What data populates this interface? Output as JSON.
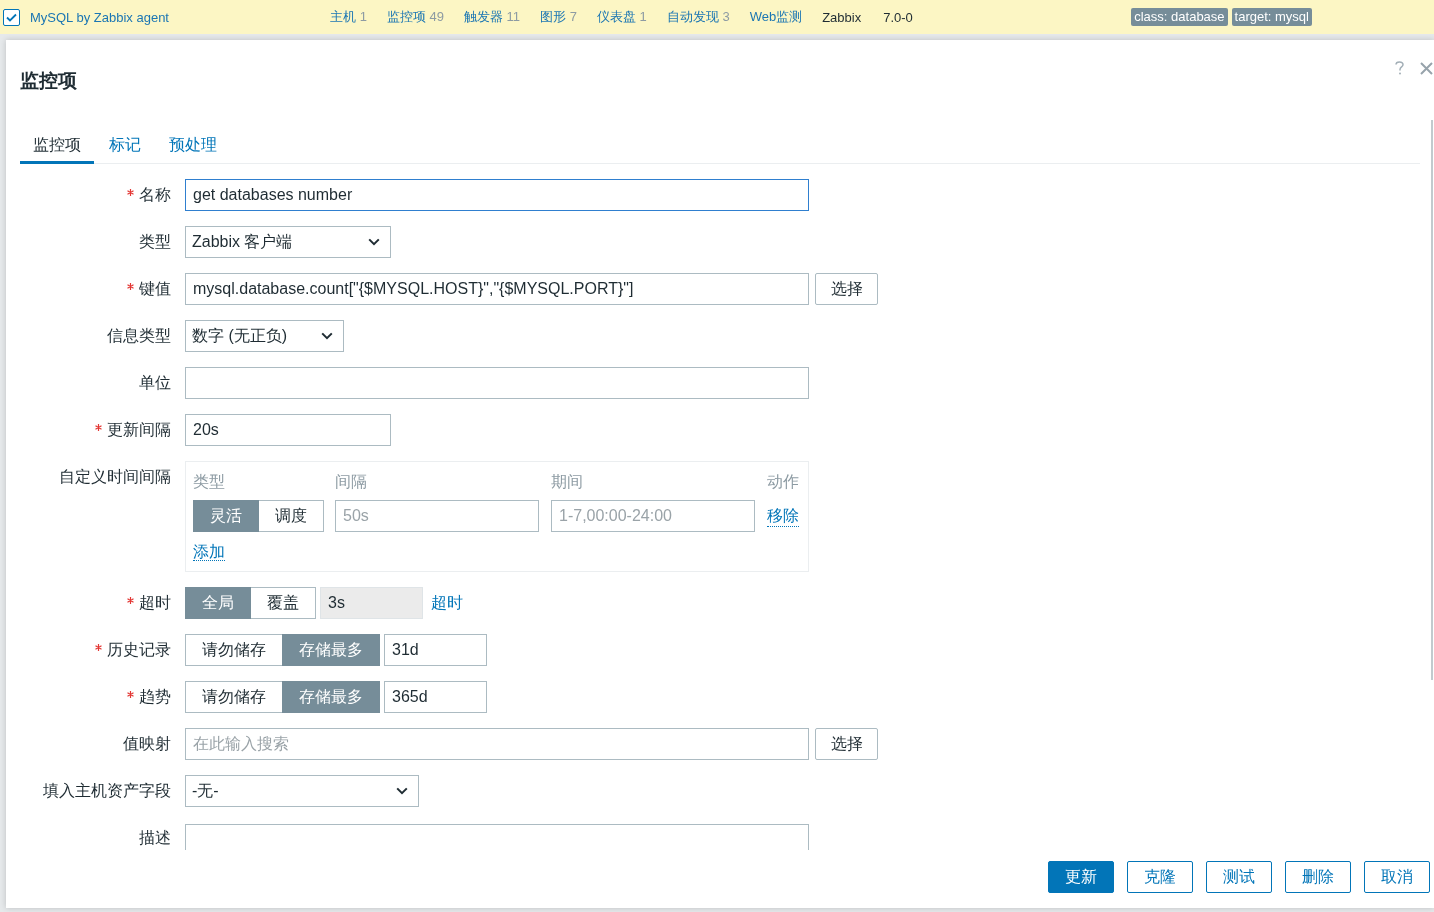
{
  "host_bar": {
    "checked": true,
    "template": "MySQL by Zabbix agent",
    "nav": [
      {
        "kind": "link",
        "label": "主机",
        "count": "1"
      },
      {
        "kind": "link",
        "label": "监控项",
        "count": "49"
      },
      {
        "kind": "link",
        "label": "触发器",
        "count": "11"
      },
      {
        "kind": "link",
        "label": "图形",
        "count": "7"
      },
      {
        "kind": "link",
        "label": "仪表盘",
        "count": "1"
      },
      {
        "kind": "link",
        "label": "自动发现",
        "count": "3"
      },
      {
        "kind": "link",
        "label": "Web监测"
      },
      {
        "kind": "text",
        "label": "Zabbix"
      },
      {
        "kind": "text",
        "label": "7.0-0"
      }
    ],
    "tags": [
      "class: database",
      "target: mysql"
    ]
  },
  "dialog": {
    "title": "监控项"
  },
  "tabs": [
    {
      "label": "监控项",
      "selected": true
    },
    {
      "label": "标记",
      "selected": false
    },
    {
      "label": "预处理",
      "selected": false
    }
  ],
  "form": [
    {
      "label": "名称",
      "required": true,
      "kind": "input",
      "value": "get databases number",
      "focused": true
    },
    {
      "label": "类型",
      "required": false,
      "kind": "select",
      "value": "Zabbix 客户端"
    },
    {
      "label": "键值",
      "required": true,
      "kind": "input",
      "value": "mysql.database.count[\"{$MYSQL.HOST}\",\"{$MYSQL.PORT}\"]",
      "focused": false,
      "button": "选择"
    },
    {
      "label": "信息类型",
      "required": false,
      "kind": "select",
      "value": "数字 (无正负)"
    },
    {
      "label": "单位",
      "required": false,
      "kind": "input",
      "focused": false
    },
    {
      "label": "更新间隔",
      "required": true,
      "kind": "short_input",
      "value": "20s"
    },
    {
      "label": "自定义时间间隔",
      "required": false,
      "kind": "intervals",
      "columns": [
        "类型",
        "间隔",
        "期间",
        "动作"
      ],
      "rows": [
        {
          "options": [
            {
              "label": "灵活",
              "selected": true
            },
            {
              "label": "调度",
              "selected": false
            }
          ],
          "interval_placeholder": "50s",
          "period_placeholder": "1-7,00:00-24:00",
          "action": "移除"
        }
      ],
      "add": "添加"
    },
    {
      "label": "超时",
      "required": true,
      "kind": "toggle_input",
      "options": [
        {
          "label": "全局",
          "selected": true
        },
        {
          "label": "覆盖",
          "selected": false
        }
      ],
      "value": "3s",
      "disabled": true,
      "link": "超时"
    },
    {
      "label": "历史记录",
      "required": true,
      "kind": "toggle_input",
      "options": [
        {
          "label": "请勿储存",
          "selected": false
        },
        {
          "label": "存储最多",
          "selected": true
        }
      ],
      "value": "31d",
      "disabled": false
    },
    {
      "label": "趋势",
      "required": true,
      "kind": "toggle_input",
      "options": [
        {
          "label": "请勿储存",
          "selected": false
        },
        {
          "label": "存储最多",
          "selected": true
        }
      ],
      "value": "365d",
      "disabled": false
    },
    {
      "label": "值映射",
      "required": false,
      "kind": "input",
      "placeholder": "在此输入搜索",
      "focused": false,
      "button": "选择"
    },
    {
      "label": "填入主机资产字段",
      "required": false,
      "kind": "select",
      "value": "-无-"
    },
    {
      "label": "描述",
      "required": false,
      "kind": "textarea"
    }
  ],
  "buttons": [
    {
      "label": "更新",
      "primary": true
    },
    {
      "label": "克隆",
      "primary": false
    },
    {
      "label": "测试",
      "primary": false
    },
    {
      "label": "删除",
      "primary": false
    },
    {
      "label": "取消",
      "primary": false
    }
  ]
}
